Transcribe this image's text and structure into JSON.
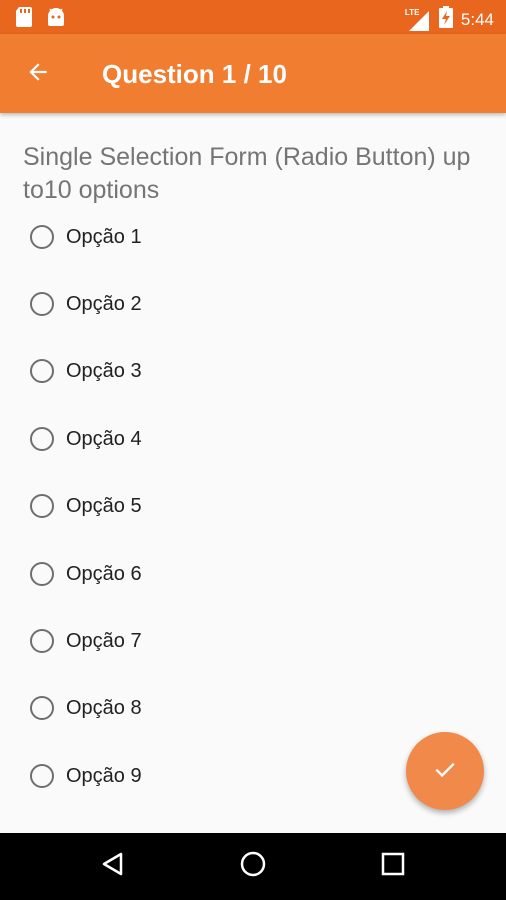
{
  "status_bar": {
    "time": "5:44",
    "network_label": "LTE",
    "icons": [
      "sd-card-icon",
      "android-icon",
      "signal-icon",
      "battery-charging-icon"
    ]
  },
  "app_bar": {
    "title": "Question 1 / 10",
    "back_icon": "arrow-left-icon"
  },
  "question": {
    "text": "Single Selection Form (Radio Button) up to10 options"
  },
  "options": [
    {
      "label": "Opção 1",
      "selected": false
    },
    {
      "label": "Opção 2",
      "selected": false
    },
    {
      "label": "Opção 3",
      "selected": false
    },
    {
      "label": "Opção 4",
      "selected": false
    },
    {
      "label": "Opção 5",
      "selected": false
    },
    {
      "label": "Opção 6",
      "selected": false
    },
    {
      "label": "Opção 7",
      "selected": false
    },
    {
      "label": "Opção 8",
      "selected": false
    },
    {
      "label": "Opção 9",
      "selected": false
    }
  ],
  "fab": {
    "icon": "check-icon"
  },
  "nav_bar": {
    "icons": [
      "back-triangle-icon",
      "home-circle-icon",
      "recents-square-icon"
    ]
  },
  "colors": {
    "status_bar": "#e8661e",
    "app_bar": "#f07d30",
    "fab": "#f0894a",
    "background": "#fafafa"
  }
}
